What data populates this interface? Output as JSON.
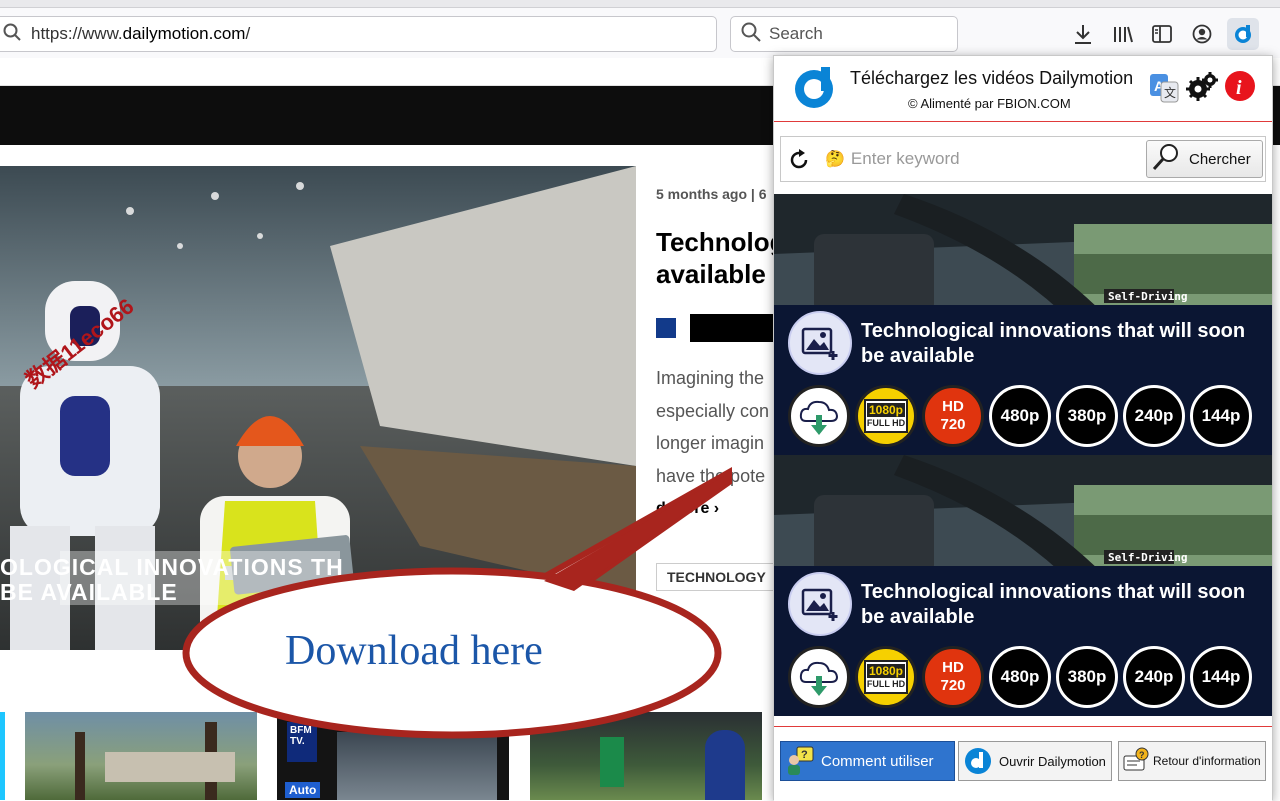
{
  "browser": {
    "url_scheme": "https://www.",
    "url_domain": "dailymotion.com",
    "url_path": "/",
    "search_placeholder": "Search",
    "toolbar_icons": [
      "download-icon",
      "library-icon",
      "sidebar-icon",
      "account-icon",
      "extension-icon"
    ]
  },
  "page": {
    "hero_overlay_line1": "OLOGICAL INNOVATIONS TH",
    "hero_overlay_line2": "BE AVAILABLE",
    "hero_watermark": "数据11eco66",
    "meta": "5 months ago  |  6",
    "title_line1": "Technolog",
    "title_line2": "available",
    "desc_line1": "Imagining the",
    "desc_line2": "especially con",
    "desc_line3": "longer imagin",
    "desc_line4": "have the pote",
    "read_more": "d more",
    "tag": "TECHNOLOGY",
    "thumb2_badge": "Auto",
    "thumb2_logo": "BFM TV."
  },
  "callout": {
    "text": "Download here"
  },
  "popup": {
    "title": "Téléchargez les vidéos Dailymotion",
    "subtitle": "© Alimenté par FBION.COM",
    "keyword_placeholder": "Enter keyword",
    "search_button": "Chercher",
    "cards": [
      {
        "title": "Technological innovations that will soon be available",
        "qualities": [
          "1080p",
          "HD 720",
          "480p",
          "380p",
          "240p",
          "144p"
        ],
        "bg_text": "Self-Driving"
      },
      {
        "title": "Technological innovations that will soon be available",
        "qualities": [
          "1080p",
          "HD 720",
          "480p",
          "380p",
          "240p",
          "144p"
        ],
        "bg_text": "Self-Driving"
      }
    ],
    "footer": {
      "how_to": "Comment utiliser",
      "open_dm": "Ouvrir Dailymotion",
      "feedback": "Retour d'information"
    }
  },
  "colors": {
    "accent_red": "#e03a3a",
    "dm_blue": "#0a84d6",
    "card_band": "#0b1633"
  }
}
